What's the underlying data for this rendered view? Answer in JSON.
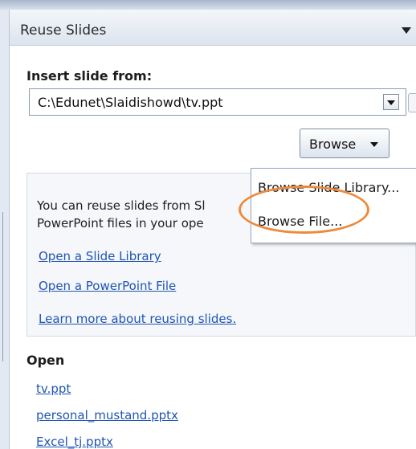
{
  "pane": {
    "title": "Reuse Slides",
    "menu_icon": "triangle-down-icon"
  },
  "insert": {
    "label": "Insert slide from:",
    "source_value": "C:\\Edunet\\Slaidishowd\\tv.ppt",
    "browse_label": "Browse"
  },
  "browse_menu": {
    "items": [
      {
        "label": "Browse Slide Library..."
      },
      {
        "label": "Browse File..."
      }
    ]
  },
  "info": {
    "line1": "You can reuse slides from Sl",
    "line2": "PowerPoint files in your ope",
    "links": [
      {
        "label": "Open a Slide Library"
      },
      {
        "label": "Open a PowerPoint File"
      },
      {
        "label": "Learn more about reusing slides."
      }
    ]
  },
  "open": {
    "label": "Open",
    "files": [
      {
        "label": "tv.ppt"
      },
      {
        "label": "personal_mustand.pptx"
      },
      {
        "label": "Excel_tj.pptx"
      }
    ]
  },
  "colors": {
    "link": "#1f55b3",
    "highlight": "#ec8b3e"
  }
}
